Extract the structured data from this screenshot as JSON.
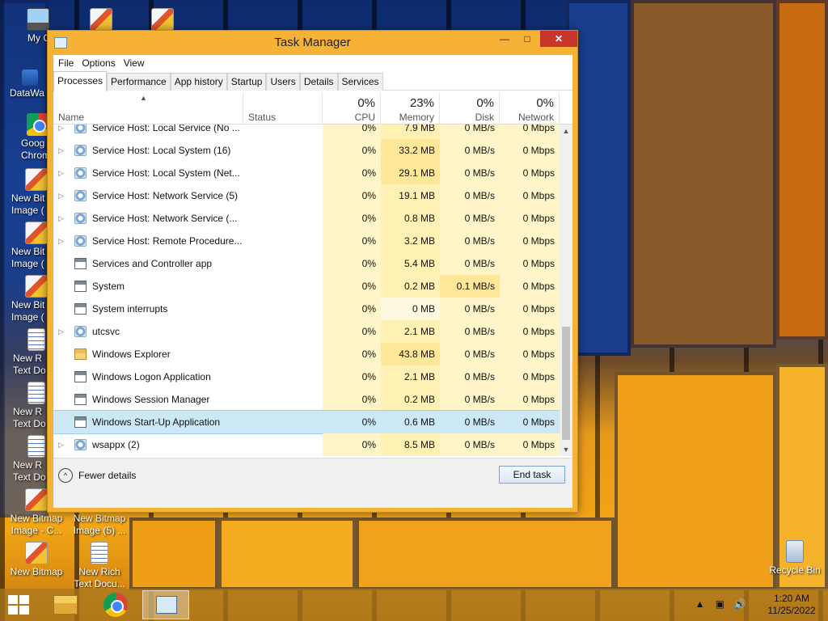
{
  "desktop": {
    "icons": [
      {
        "label": "My Compu"
      },
      {
        "label": "DataWa"
      },
      {
        "label": "Goog Chrom"
      },
      {
        "label": "New Bit Image ("
      },
      {
        "label": "New Bit Image ("
      },
      {
        "label": "New Bit Image ("
      },
      {
        "label": "New R Text Do"
      },
      {
        "label": "New R Text Do"
      },
      {
        "label": "New R Text Do"
      },
      {
        "label": "New Bitmap Image - C..."
      },
      {
        "label": "New Bitmap Image (5) ..."
      },
      {
        "label": "New Bitmap Image - C..."
      },
      {
        "label": "New Rich Text Docu..."
      },
      {
        "label": "Recycle Bin"
      }
    ]
  },
  "window": {
    "title": "Task Manager",
    "min_glyph": "—",
    "max_glyph": "□",
    "close_glyph": "✕"
  },
  "menu": [
    "File",
    "Options",
    "View"
  ],
  "tabs": [
    "Processes",
    "Performance",
    "App history",
    "Startup",
    "Users",
    "Details",
    "Services"
  ],
  "active_tab": "Processes",
  "columns": {
    "name": "Name",
    "status": "Status",
    "cpu": {
      "pct": "0%",
      "label": "CPU"
    },
    "memory": {
      "pct": "23%",
      "label": "Memory"
    },
    "disk": {
      "pct": "0%",
      "label": "Disk"
    },
    "network": {
      "pct": "0%",
      "label": "Network"
    }
  },
  "processes": [
    {
      "name": "Service Host: Local Service (No ...",
      "icon": "gear-icon",
      "expand": true,
      "cpu": "0%",
      "memory": "7.9 MB",
      "disk": "0 MB/s",
      "network": "0 Mbps"
    },
    {
      "name": "Service Host: Local System (16)",
      "icon": "gear-icon",
      "expand": true,
      "cpu": "0%",
      "memory": "33.2 MB",
      "disk": "0 MB/s",
      "network": "0 Mbps"
    },
    {
      "name": "Service Host: Local System (Net...",
      "icon": "gear-icon",
      "expand": true,
      "cpu": "0%",
      "memory": "29.1 MB",
      "disk": "0 MB/s",
      "network": "0 Mbps"
    },
    {
      "name": "Service Host: Network Service (5)",
      "icon": "gear-icon",
      "expand": true,
      "cpu": "0%",
      "memory": "19.1 MB",
      "disk": "0 MB/s",
      "network": "0 Mbps"
    },
    {
      "name": "Service Host: Network Service (...",
      "icon": "gear-icon",
      "expand": true,
      "cpu": "0%",
      "memory": "0.8 MB",
      "disk": "0 MB/s",
      "network": "0 Mbps"
    },
    {
      "name": "Service Host: Remote Procedure...",
      "icon": "gear-icon",
      "expand": true,
      "cpu": "0%",
      "memory": "3.2 MB",
      "disk": "0 MB/s",
      "network": "0 Mbps"
    },
    {
      "name": "Services and Controller app",
      "icon": "app-icon",
      "expand": false,
      "cpu": "0%",
      "memory": "5.4 MB",
      "disk": "0 MB/s",
      "network": "0 Mbps"
    },
    {
      "name": "System",
      "icon": "app-icon",
      "expand": false,
      "cpu": "0%",
      "memory": "0.2 MB",
      "disk": "0.1 MB/s",
      "network": "0 Mbps"
    },
    {
      "name": "System interrupts",
      "icon": "app-icon",
      "expand": false,
      "cpu": "0%",
      "memory": "0 MB",
      "disk": "0 MB/s",
      "network": "0 Mbps"
    },
    {
      "name": "utcsvc",
      "icon": "gear-icon",
      "expand": true,
      "cpu": "0%",
      "memory": "2.1 MB",
      "disk": "0 MB/s",
      "network": "0 Mbps"
    },
    {
      "name": "Windows Explorer",
      "icon": "folder-icon",
      "expand": false,
      "cpu": "0%",
      "memory": "43.8 MB",
      "disk": "0 MB/s",
      "network": "0 Mbps"
    },
    {
      "name": "Windows Logon Application",
      "icon": "app-icon",
      "expand": false,
      "cpu": "0%",
      "memory": "2.1 MB",
      "disk": "0 MB/s",
      "network": "0 Mbps"
    },
    {
      "name": "Windows Session Manager",
      "icon": "app-icon",
      "expand": false,
      "cpu": "0%",
      "memory": "0.2 MB",
      "disk": "0 MB/s",
      "network": "0 Mbps"
    },
    {
      "name": "Windows Start-Up Application",
      "icon": "app-icon",
      "expand": false,
      "selected": true,
      "cpu": "0%",
      "memory": "0.6 MB",
      "disk": "0 MB/s",
      "network": "0 Mbps"
    },
    {
      "name": "wsappx (2)",
      "icon": "gear-icon",
      "expand": true,
      "cpu": "0%",
      "memory": "8.5 MB",
      "disk": "0 MB/s",
      "network": "0 Mbps"
    }
  ],
  "footer": {
    "fewer_details": "Fewer details",
    "end_task": "End task"
  },
  "taskbar": {
    "time": "1:20 AM",
    "date": "11/25/2022"
  }
}
